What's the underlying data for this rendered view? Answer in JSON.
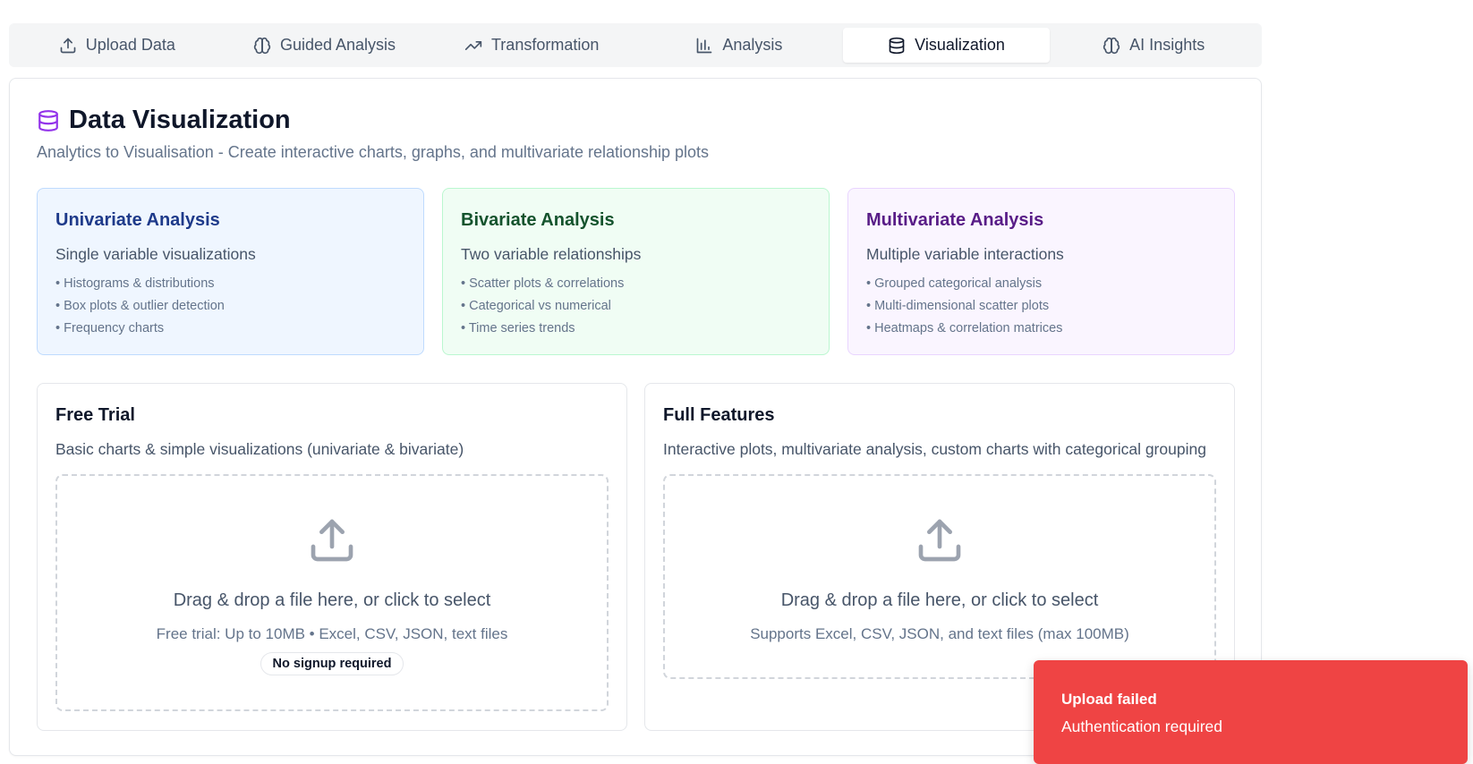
{
  "tabs": [
    {
      "label": "Upload Data",
      "icon": "upload-icon"
    },
    {
      "label": "Guided Analysis",
      "icon": "brain-icon"
    },
    {
      "label": "Transformation",
      "icon": "trending-up-icon"
    },
    {
      "label": "Analysis",
      "icon": "bar-chart-icon"
    },
    {
      "label": "Visualization",
      "icon": "database-icon",
      "active": true
    },
    {
      "label": "AI Insights",
      "icon": "brain-icon"
    }
  ],
  "page": {
    "title": "Data Visualization",
    "subtitle": "Analytics to Visualisation - Create interactive charts, graphs, and multivariate relationship plots",
    "title_icon": "database-icon",
    "accent_color": "#9333ea"
  },
  "categories": {
    "univariate": {
      "title": "Univariate Analysis",
      "description": "Single variable visualizations",
      "items": [
        "• Histograms & distributions",
        "• Box plots & outlier detection",
        "• Frequency charts"
      ]
    },
    "bivariate": {
      "title": "Bivariate Analysis",
      "description": "Two variable relationships",
      "items": [
        "• Scatter plots & correlations",
        "• Categorical vs numerical",
        "• Time series trends"
      ]
    },
    "multivariate": {
      "title": "Multivariate Analysis",
      "description": "Multiple variable interactions",
      "items": [
        "• Grouped categorical analysis",
        "• Multi-dimensional scatter plots",
        "• Heatmaps & correlation matrices"
      ]
    }
  },
  "free_trial": {
    "title": "Free Trial",
    "description": "Basic charts & simple visualizations (univariate & bivariate)",
    "drop_text": "Drag & drop a file here, or click to select",
    "limits": "Free trial: Up to 10MB • Excel, CSV, JSON, text files",
    "badge": "No signup required"
  },
  "full_features": {
    "title": "Full Features",
    "description": "Interactive plots, multivariate analysis, custom charts with categorical grouping",
    "drop_text": "Drag & drop a file here, or click to select",
    "limits": "Supports Excel, CSV, JSON, and text files (max 100MB)"
  },
  "toast": {
    "title": "Upload failed",
    "message": "Authentication required",
    "color": "#ef4444"
  }
}
